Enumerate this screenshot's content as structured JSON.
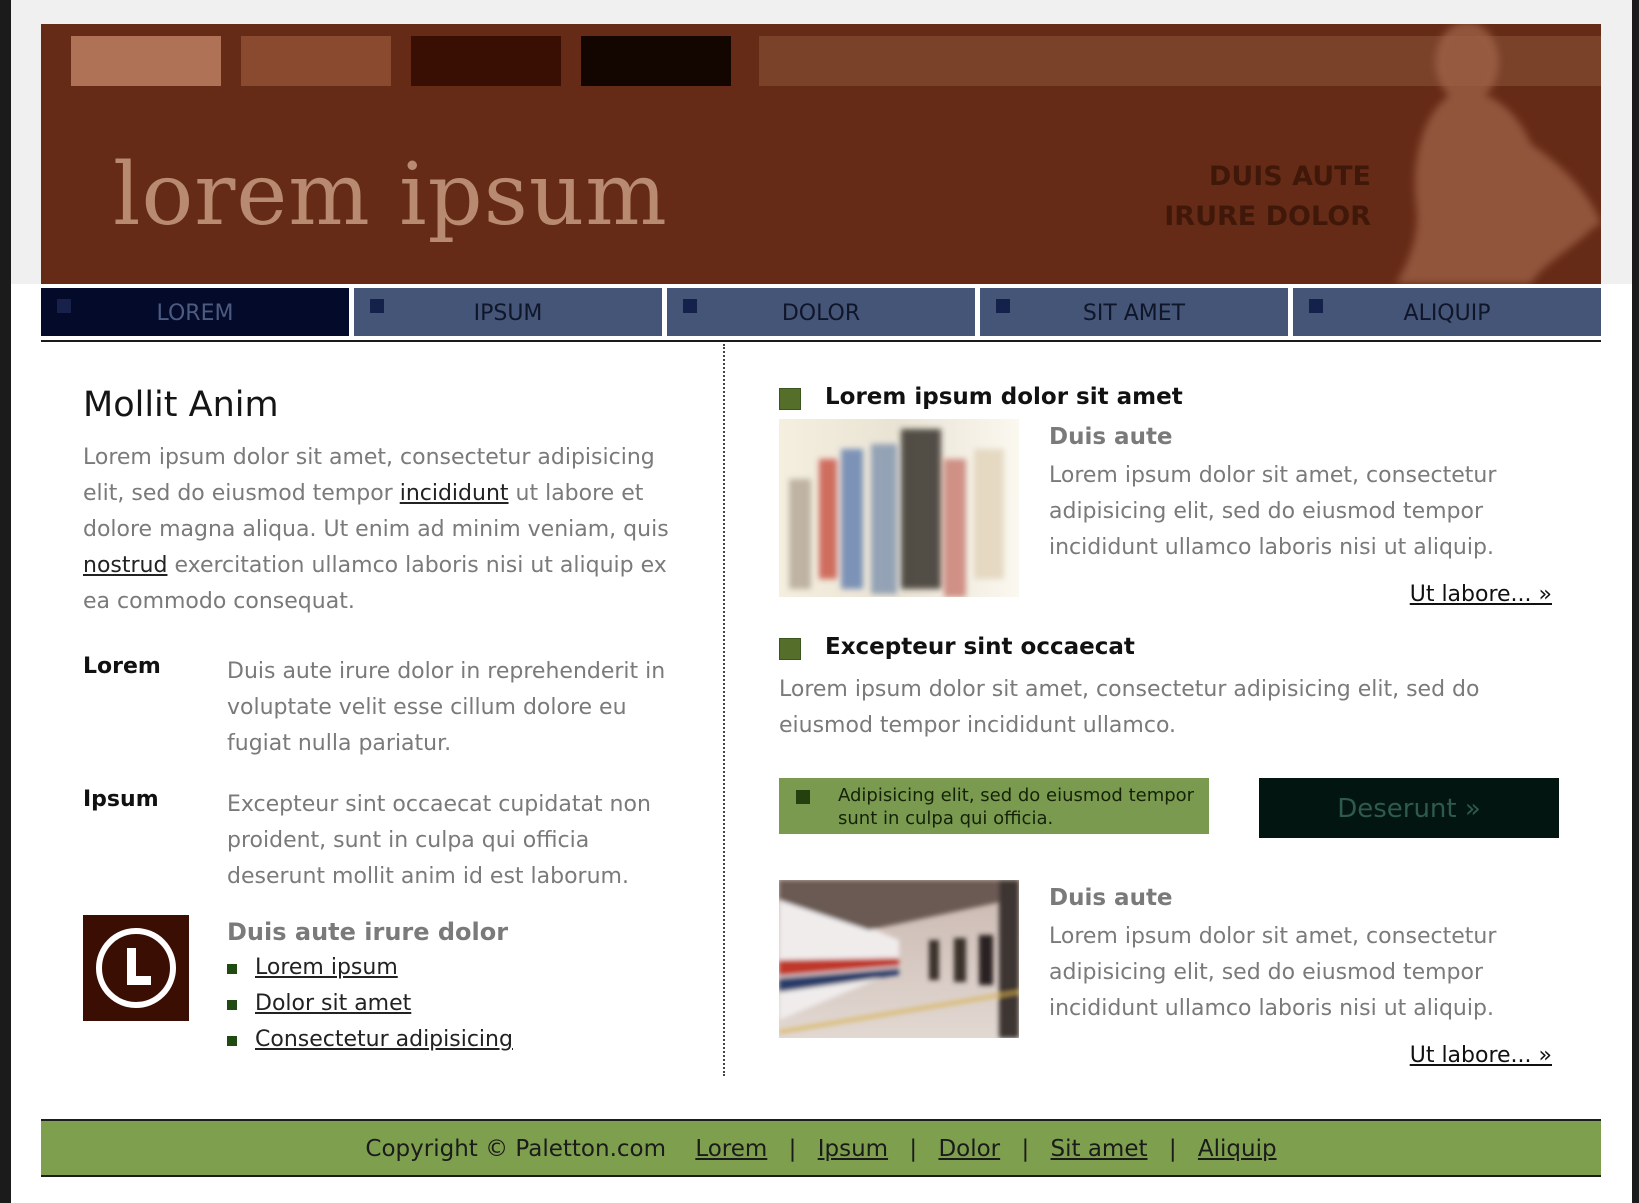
{
  "header": {
    "logo_text": "lorem ipsum",
    "tagline_line1": "DUIS AUTE",
    "tagline_line2": "IRURE DOLOR"
  },
  "nav": {
    "items": [
      {
        "label": "LOREM",
        "active": true
      },
      {
        "label": "IPSUM",
        "active": false
      },
      {
        "label": "DOLOR",
        "active": false
      },
      {
        "label": "SIT AMET",
        "active": false
      },
      {
        "label": "ALIQUIP",
        "active": false
      }
    ]
  },
  "left": {
    "title": "Mollit Anim",
    "intro_part1": "Lorem ipsum dolor sit amet, consectetur adipisicing elit, sed do eiusmod tempor ",
    "intro_link1": "incididunt",
    "intro_part2": " ut labore et dolore magna aliqua. Ut enim ad minim veniam, quis ",
    "intro_link2": "nostrud",
    "intro_part3": " exercitation ullamco laboris nisi ut aliquip ex ea commodo consequat.",
    "definitions": [
      {
        "term": "Lorem",
        "desc": "Duis aute irure dolor in reprehenderit in voluptate velit esse cillum dolore eu fugiat nulla pariatur."
      },
      {
        "term": "Ipsum",
        "desc": "Excepteur sint occaecat cupidatat non proident, sunt in culpa qui officia deserunt mollit anim id est laborum."
      }
    ],
    "links_title": "Duis aute irure dolor",
    "links": [
      "Lorem ipsum",
      "Dolor sit amet",
      "Consectetur adipisicing"
    ]
  },
  "right": {
    "section1_title": "Lorem ipsum dolor sit amet",
    "article1": {
      "subtitle": "Duis aute",
      "body": "Lorem ipsum dolor sit amet, consectetur adipisicing elit, sed do eiusmod tempor incididunt ullamco laboris nisi ut aliquip.",
      "more": "Ut labore... »"
    },
    "section2_title": "Excepteur sint occaecat",
    "section2_body": "Lorem ipsum dolor sit amet, consectetur adipisicing elit, sed do eiusmod tempor incididunt ullamco.",
    "notice": "Adipisicing elit, sed do eiusmod tempor sunt in culpa qui officia.",
    "cta": "Deserunt »",
    "article2": {
      "subtitle": "Duis aute",
      "body": "Lorem ipsum dolor sit amet, consectetur adipisicing elit, sed do eiusmod tempor incididunt ullamco laboris nisi ut aliquip.",
      "more": "Ut labore... »"
    }
  },
  "footer": {
    "copyright": "Copyright © Paletton.com",
    "links": [
      "Lorem",
      "Ipsum",
      "Dolor",
      "Sit amet",
      "Aliquip"
    ],
    "separator": "|"
  },
  "colors": {
    "header_bg": "#662b16",
    "nav_bg": "#445577",
    "nav_active_bg": "#030a2a",
    "accent_green": "#7ea04e",
    "bullet_green": "#556f2a",
    "cta_bg": "#031511"
  },
  "icons": {
    "logo": "circled-letter-l-icon",
    "nav_marker": "square-bullet-icon"
  }
}
